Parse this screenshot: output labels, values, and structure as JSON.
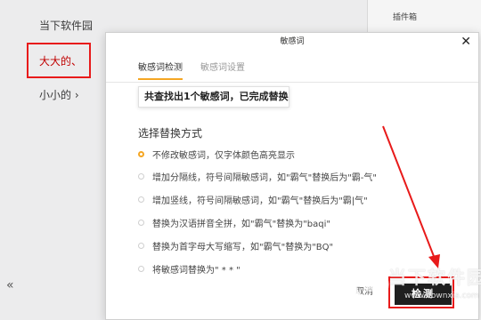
{
  "editor": {
    "lines": [
      "当下软件园",
      "大大的、",
      "小小的 ›"
    ],
    "collapse_icon": "double-chevron-left-icon"
  },
  "plugin_panel": {
    "title": "插件箱"
  },
  "dialog": {
    "title": "敏感词",
    "close_icon": "close-icon",
    "tabs": [
      {
        "label": "敏感词检测",
        "active": true
      },
      {
        "label": "敏感词设置",
        "active": false
      }
    ],
    "result_text": "共查找出1个敏感词，已完成替换",
    "section_label": "选择替换方式",
    "options": [
      {
        "label": "不修改敏感词，仅字体颜色高亮显示",
        "checked": true
      },
      {
        "label": "增加分隔线，符号间隔敏感词，如\"霸气\"替换后为\"霸-气\"",
        "checked": false
      },
      {
        "label": "增加竖线，符号间隔敏感词，如\"霸气\"替换后为\"霸|气\"",
        "checked": false
      },
      {
        "label": "替换为汉语拼音全拼，如\"霸气\"替换为\"baqi\"",
        "checked": false
      },
      {
        "label": "替换为首字母大写缩写，如\"霸气\"替换为\"BQ\"",
        "checked": false
      },
      {
        "label": "将敏感词替换为\" * * \"",
        "checked": false
      }
    ],
    "cancel_label": "取消",
    "detect_label": "检测"
  },
  "watermark": {
    "text": "当下软件园",
    "sub": "www.downxia.com"
  },
  "colors": {
    "accent": "#f5a623",
    "annotation_red": "#e81a1a",
    "button_dark": "#1f1f1f"
  }
}
